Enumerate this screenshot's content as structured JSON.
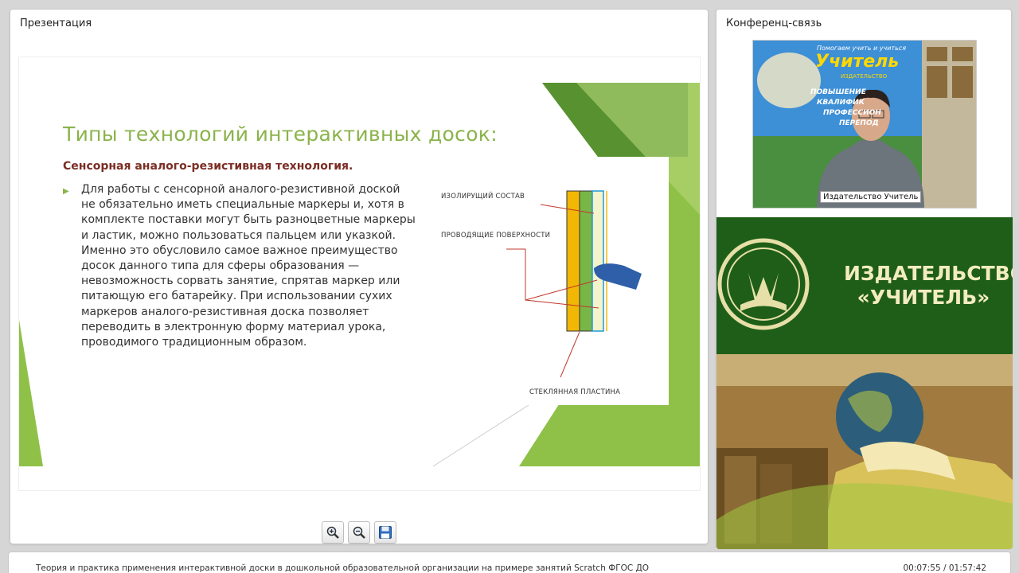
{
  "presentation": {
    "title": "Презентация",
    "slide": {
      "heading": "Типы технологий интерактивных досок:",
      "subheading": "Сенсорная аналого-резистивная технология.",
      "body": "Для работы с сенсорной аналого-резистивной доской не обязательно иметь специальные маркеры и, хотя в комплекте поставки могут быть разноцветные маркеры и ластик, можно пользоваться пальцем или указкой. Именно это обусловило самое важное преимущество досок данного типа для сферы образования — невозможность сорвать занятие, спрятав маркер или питающую его батарейку. При использовании сухих маркеров аналого-резистивная доска позволяет переводить в электронную форму материал урока, проводимого традиционным образом.",
      "diagram_labels": {
        "insulating": "ИЗОЛИРУЩИЙ СОСТАВ",
        "conductive": "ПРОВОДЯЩИЕ ПОВЕРХНОСТИ",
        "glass": "СТЕКЛЯННАЯ ПЛАСТИНА"
      }
    },
    "toolbar": {
      "zoom_in_icon": "zoom-in-icon",
      "zoom_out_icon": "zoom-out-icon",
      "save_icon": "floppy-disk-icon"
    }
  },
  "conference": {
    "title": "Конференц-связь",
    "video_caption": "Издательство Учитель",
    "backdrop_text": {
      "top": "Помогаем учить и учиться",
      "brand": "Учитель",
      "brand_sub": "ИЗДАТЕЛЬСТВО",
      "item1": "ПОВЫШЕНИЕ",
      "item2": "КВАЛИФИК",
      "item3": "ПРОФЕССИОН",
      "item4": "ПЕРЕПОД"
    },
    "publisher_line1": "ИЗДАТЕЛЬСТВО",
    "publisher_line2": "«УЧИТЕЛЬ»"
  },
  "footer": {
    "title": "Теория и практика применения интерактивной доски в дошкольной образовательной организации на примере занятий Scratch ФГОС ДО",
    "time": "00:07:55 / 01:57:42"
  },
  "colors": {
    "accent_green": "#8ab34b",
    "dark_green": "#1d5a14",
    "heading_brown": "#7b2d24"
  }
}
